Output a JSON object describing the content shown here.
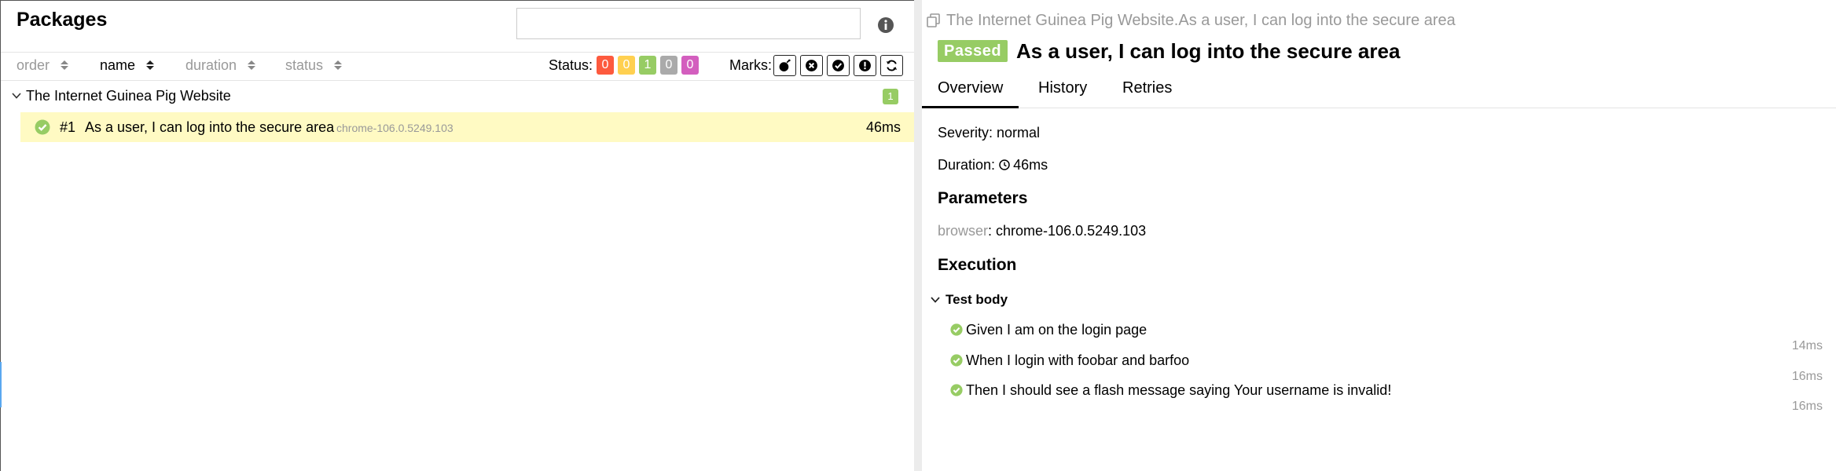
{
  "left": {
    "title": "Packages",
    "search": {
      "value": "",
      "placeholder": ""
    },
    "sorters": [
      {
        "label": "order"
      },
      {
        "label": "name"
      },
      {
        "label": "duration"
      },
      {
        "label": "status"
      }
    ],
    "status_label": "Status:",
    "status_counts": [
      {
        "value": "0",
        "color": "#fd5a3e"
      },
      {
        "value": "0",
        "color": "#ffd050"
      },
      {
        "value": "1",
        "color": "#97cc64"
      },
      {
        "value": "0",
        "color": "#aaaaaa"
      },
      {
        "value": "0",
        "color": "#d35ebe"
      }
    ],
    "marks_label": "Marks:",
    "marks": [
      "flaky-icon",
      "new-failed-icon",
      "new-passed-icon",
      "new-broken-icon",
      "retries-icon"
    ],
    "group": {
      "title": "The Internet Guinea Pig Website",
      "count": "1"
    },
    "test": {
      "number": "#1",
      "name": "As a user, I can log into the secure area",
      "param": "chrome-106.0.5249.103",
      "duration": "46ms",
      "status_color": "#97cc64"
    }
  },
  "right": {
    "path": "The Internet Guinea Pig Website.As a user, I can log into the secure area",
    "status": "Passed",
    "title": "As a user, I can log into the secure area",
    "tabs": [
      "Overview",
      "History",
      "Retries"
    ],
    "severity": "Severity: normal",
    "duration_label": "Duration:",
    "duration_value": "46ms",
    "parameters_heading": "Parameters",
    "param_name": "browser",
    "param_value": ": chrome-106.0.5249.103",
    "execution_heading": "Execution",
    "test_body_label": "Test body",
    "steps": [
      {
        "text": "Given I am on the login page",
        "duration": "14ms"
      },
      {
        "text": "When I login with foobar and barfoo",
        "duration": "16ms"
      },
      {
        "text": "Then I should see a flash message saying Your username is invalid!",
        "duration": "16ms"
      }
    ]
  }
}
